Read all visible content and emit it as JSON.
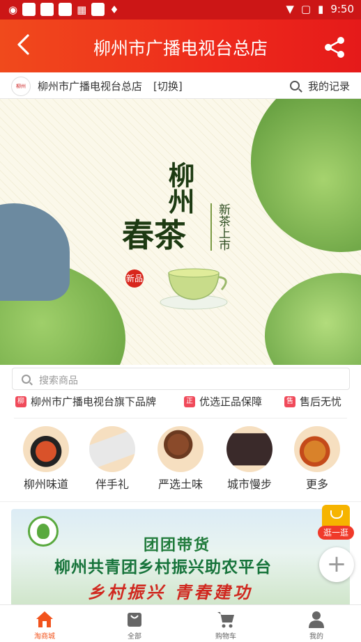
{
  "status_bar": {
    "time": "9:50"
  },
  "app_bar": {
    "title": "柳州市广播电视台总店"
  },
  "store_bar": {
    "store_name": "柳州市广播电视台总店",
    "switch_label": "[切换]",
    "records_label": "我的记录",
    "logo_text": "柳州"
  },
  "banner": {
    "main_text": "春茶",
    "top_text": "柳州",
    "side_text": "新茶上市",
    "seal_text": "新品"
  },
  "search": {
    "placeholder": "搜索商品"
  },
  "badges": [
    {
      "icon": "柳",
      "label": "柳州市广播电视台旗下品牌"
    },
    {
      "icon": "正",
      "label": "优选正品保障"
    },
    {
      "icon": "售",
      "label": "售后无忧"
    }
  ],
  "categories": [
    {
      "label": "柳州味道"
    },
    {
      "label": "伴手礼"
    },
    {
      "label": "严选土味"
    },
    {
      "label": "城市慢步"
    },
    {
      "label": "更多"
    }
  ],
  "promo": {
    "line1": "团团带货",
    "line2": "柳州共青团乡村振兴助农平台",
    "line3": "乡村振兴 青春建功"
  },
  "float": {
    "go_label": "逛一逛",
    "add_label": "+"
  },
  "tabs": [
    {
      "label": "淘商城"
    },
    {
      "label": "全部"
    },
    {
      "label": "购物车"
    },
    {
      "label": "我的"
    }
  ],
  "colors": {
    "brand": "#e8281c",
    "active_tab": "#f2531c"
  }
}
